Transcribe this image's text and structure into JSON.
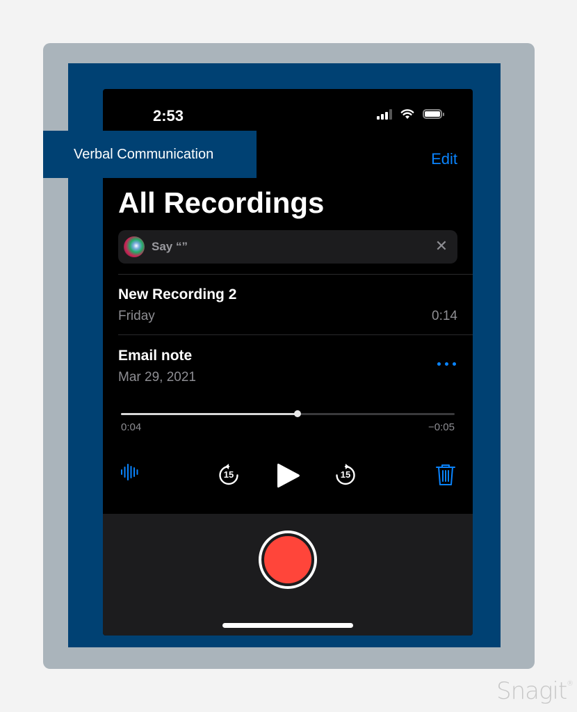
{
  "status_bar": {
    "time": "2:53",
    "signal_bars": 3,
    "signal_bars_total": 4,
    "battery_icon": "battery-full"
  },
  "nav": {
    "edit_label": "Edit"
  },
  "page_title": "All Recordings",
  "siri_suggestion": {
    "text": "Say “”",
    "icon": "siri-orb",
    "close_icon": "close-x"
  },
  "recordings": [
    {
      "name": "New Recording 2",
      "date": "Friday",
      "duration": "0:14"
    },
    {
      "name": "Email note",
      "date": "Mar 29, 2021",
      "more_icon": "ellipsis"
    }
  ],
  "player": {
    "progress": 0.53,
    "elapsed": "0:04",
    "remaining": "−0:05",
    "skip_back_label": "15",
    "skip_forward_label": "15"
  },
  "colors": {
    "accent": "#0a84ff",
    "record": "#ff453a",
    "banner": "#004173"
  },
  "annotation": {
    "banner_text": "Verbal Communication"
  },
  "watermark": {
    "text": "Snagit",
    "mark": "®"
  }
}
